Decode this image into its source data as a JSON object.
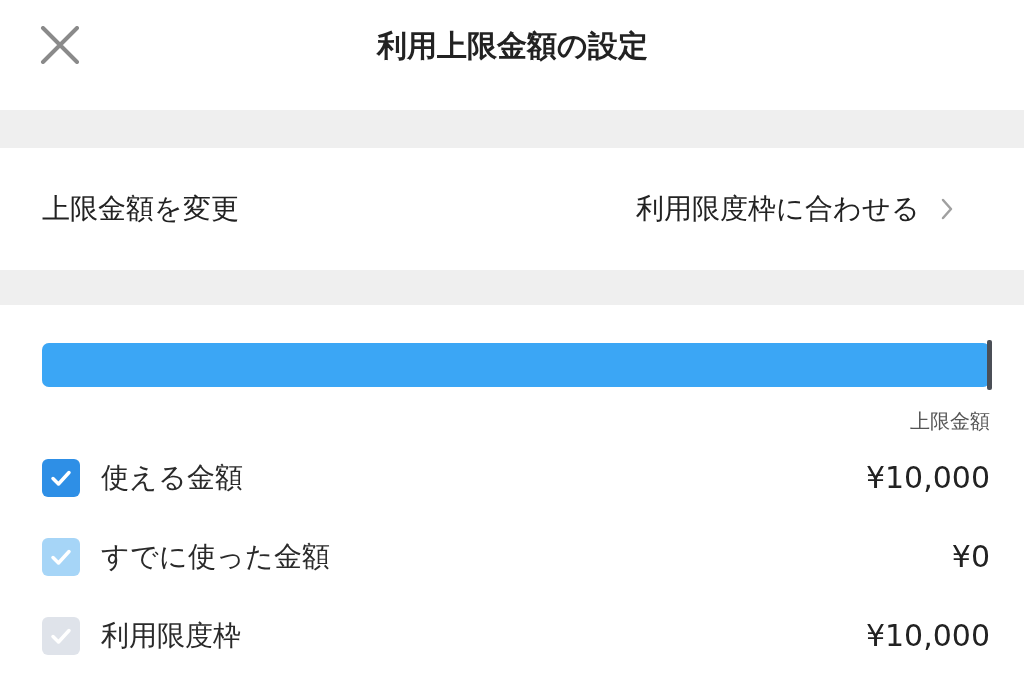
{
  "header": {
    "title": "利用上限金額の設定"
  },
  "limit_row": {
    "label": "上限金額を変更",
    "value": "利用限度枠に合わせる"
  },
  "usage_bar": {
    "level": 1,
    "limit_label": "上限金額"
  },
  "legend": [
    {
      "label": "使える金額",
      "amount": "¥10,000",
      "checked": true,
      "color": "#2e8fe6"
    },
    {
      "label": "すでに使った金額",
      "amount": "¥0",
      "checked": true,
      "color": "#a6d5f7"
    },
    {
      "label": "利用限度枠",
      "amount": "¥10,000",
      "checked": true,
      "color": "#dfe3ea"
    }
  ]
}
